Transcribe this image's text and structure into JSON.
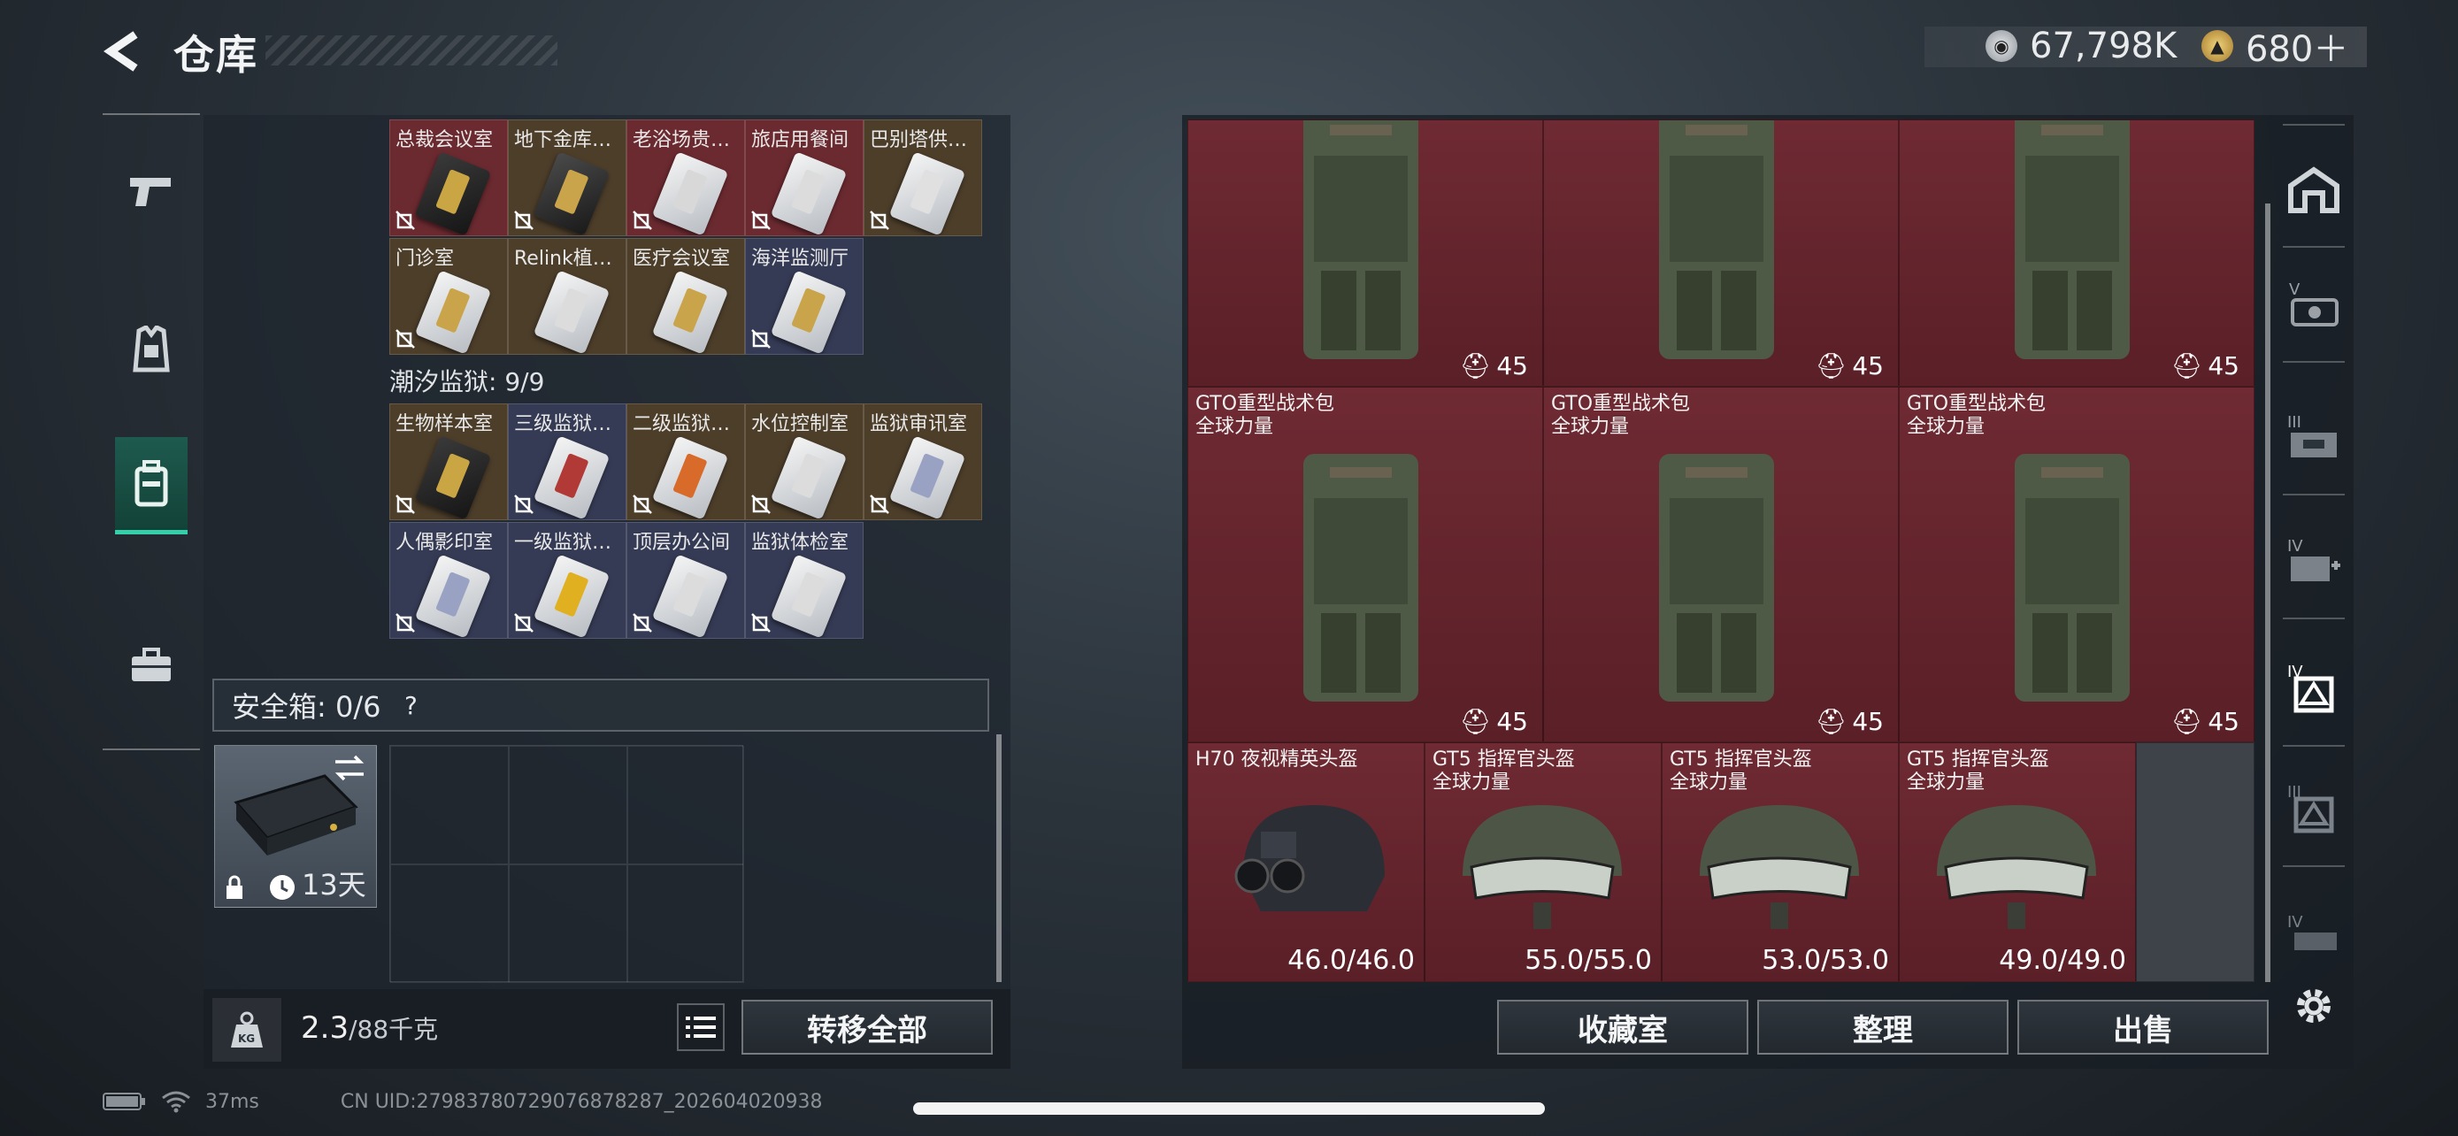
{
  "header": {
    "title": "仓库",
    "currencies": [
      {
        "icon": "silver-coin-icon",
        "value": "67,798K",
        "color": "#c9ccd0"
      },
      {
        "icon": "gold-coin-icon",
        "value": "680＋",
        "color": "#d8b45a"
      }
    ]
  },
  "left_nav": {
    "items": [
      "weapon-category",
      "armor-category",
      "backpack-category",
      "case-category"
    ],
    "active_index": 2
  },
  "keys": {
    "group1_row1": [
      "总裁会议室",
      "地下金库…",
      "老浴场贵…",
      "旅店用餐间",
      "巴别塔供…"
    ],
    "group1_row2": [
      "门诊室",
      "Relink植…",
      "医疗会议室",
      "海洋监测厅"
    ],
    "group2_title": "潮汐监狱: 9/9",
    "group2_row1": [
      "生物样本室",
      "三级监狱…",
      "二级监狱…",
      "水位控制室",
      "监狱审讯室"
    ],
    "group2_row2": [
      "人偶影印室",
      "一级监狱…",
      "顶层办公间",
      "监狱体检室"
    ]
  },
  "safebox": {
    "label": "安全箱: 0/6",
    "help": "?",
    "case_timer": "13天"
  },
  "weight": {
    "current": "2.3",
    "capacity": "/88千克"
  },
  "buttons": {
    "transfer_all": "转移全部",
    "collection": "收藏室",
    "sort": "整理",
    "sell": "出售"
  },
  "items": {
    "backpack_top_count": "45",
    "backpack_name_line1": "GTO重型战术包",
    "backpack_name_line2": "全球力量",
    "backpack_count": "45",
    "helmets": [
      {
        "name": "H70 夜视精英头盔",
        "sub": "",
        "durability": "46.0/46.0"
      },
      {
        "name": "GT5 指挥官头盔",
        "sub": "全球力量",
        "durability": "55.0/55.0"
      },
      {
        "name": "GT5 指挥官头盔",
        "sub": "全球力量",
        "durability": "53.0/53.0"
      },
      {
        "name": "GT5 指挥官头盔",
        "sub": "全球力量",
        "durability": "49.0/49.0"
      }
    ]
  },
  "right_nav": [
    "home-icon",
    "tier-v-icon",
    "tier-iii-icon",
    "tier-iv-plus-icon",
    "tier-iv-armor-icon",
    "tier-iii-armor-icon",
    "tier-iv-backpack-icon",
    "settings-icon"
  ],
  "status": {
    "ping": "37ms",
    "uid": "CN UID:2798378072907687828​7_202604020938"
  }
}
